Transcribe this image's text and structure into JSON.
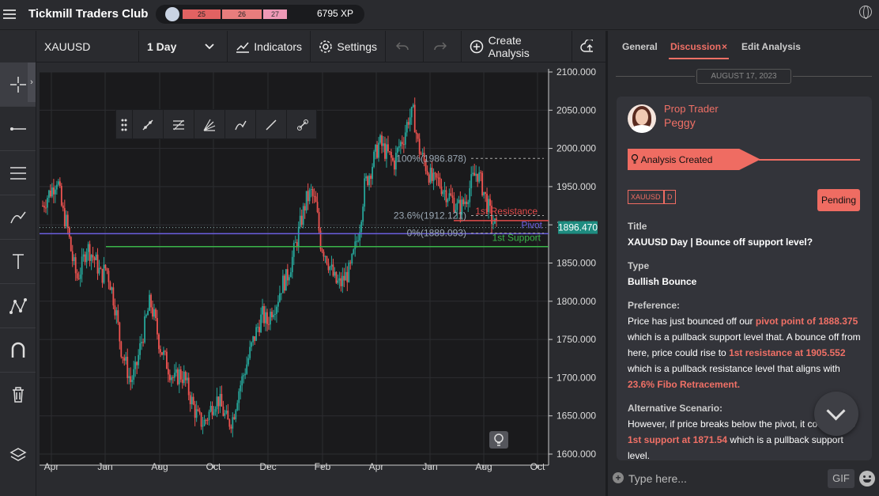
{
  "header": {
    "title": "Tickmill Traders Club",
    "xp_segments": [
      "25",
      "26",
      "27"
    ],
    "xp": "6795 XP"
  },
  "toolbar": {
    "symbol": "XAUUSD",
    "interval": "1 Day",
    "indicators": "Indicators",
    "settings": "Settings",
    "create_analysis": "Create Analysis"
  },
  "left_tools": [
    "crosshair-icon",
    "horizontal-line-icon",
    "parallel-lines-icon",
    "brush-icon",
    "text-icon",
    "pattern-icon",
    "magnet-icon",
    "trash-icon",
    "layers-icon"
  ],
  "chart_data": {
    "type": "candlestick",
    "symbol": "XAUUSD",
    "x_ticks": [
      "Apr",
      "Jun",
      "Aug",
      "Oct",
      "Dec",
      "Feb",
      "Apr",
      "Jun",
      "Aug",
      "Oct"
    ],
    "y_ticks": [
      "2100.000",
      "2050.000",
      "2000.000",
      "1950.000",
      "1900.000",
      "1850.000",
      "1800.000",
      "1750.000",
      "1700.000",
      "1650.000",
      "1600.000"
    ],
    "ylim": [
      1600,
      2100
    ],
    "current_price": "1896.470",
    "price_path": [
      1925,
      1938,
      1948,
      1962,
      1918,
      1900,
      1858,
      1830,
      1845,
      1872,
      1862,
      1850,
      1832,
      1845,
      1820,
      1788,
      1740,
      1718,
      1695,
      1708,
      1740,
      1770,
      1800,
      1775,
      1742,
      1725,
      1710,
      1696,
      1705,
      1700,
      1680,
      1660,
      1645,
      1640,
      1652,
      1668,
      1672,
      1655,
      1640,
      1648,
      1680,
      1700,
      1722,
      1745,
      1765,
      1782,
      1772,
      1790,
      1800,
      1822,
      1830,
      1852,
      1878,
      1906,
      1932,
      1942,
      1925,
      1875,
      1862,
      1843,
      1825,
      1822,
      1832,
      1840,
      1868,
      1900,
      1952,
      1968,
      1988,
      2008,
      1998,
      1990,
      1980,
      2002,
      2015,
      2040,
      2045,
      2002,
      1985,
      1970,
      1955,
      1958,
      1948,
      1940,
      1932,
      1922,
      1925,
      1938,
      1958,
      1970,
      1952,
      1930,
      1908,
      1895
    ],
    "levels": [
      {
        "label": "1st Resistance",
        "value": 1905.552,
        "color": "#e24a4a"
      },
      {
        "label": "Pivot",
        "value": 1888.375,
        "color": "#6b5fe0"
      },
      {
        "label": "1st Support",
        "value": 1871.54,
        "color": "#3ab54a"
      }
    ],
    "fib": [
      {
        "label": "100%(1986.878)",
        "value": 1986.878
      },
      {
        "label": "23.6%(1912.121)",
        "value": 1912.121
      },
      {
        "label": "0%(1889.093)",
        "value": 1889.093
      }
    ]
  },
  "panel": {
    "tabs": [
      "General",
      "Discussion",
      "Edit Analysis"
    ],
    "close_x": "×",
    "date": "AUGUST 17, 2023",
    "role": "Prop Trader",
    "user": "Peggy",
    "created": "Analysis Created",
    "tag_symbol": "XAUUSD",
    "tag_tf": "D",
    "status": "Pending",
    "title_label": "Title",
    "title": "XAUUSD Day | Bounce off support level?",
    "type_label": "Type",
    "type": "Bullish Bounce",
    "pref_label": "Preference:",
    "pref": [
      {
        "t": "Price has just bounced off our ",
        "h": false
      },
      {
        "t": "pivot point of 1888.375",
        "h": true
      },
      {
        "t": " which is a pullback support level that. A bounce off from here, price could rise to ",
        "h": false
      },
      {
        "t": "1st resistance at 1905.552",
        "h": true
      },
      {
        "t": " which is a pullback resistance level that aligns with ",
        "h": false
      },
      {
        "t": "23.6% Fibo Retracement.",
        "h": true
      }
    ],
    "alt_label": "Alternative Scenario:",
    "alt": [
      {
        "t": "However, if price breaks below the pivot, it could fall to ",
        "h": false
      },
      {
        "t": "1st support at 1871.54",
        "h": true
      },
      {
        "t": " which is a pullback support level.",
        "h": false
      }
    ],
    "placeholder": "Type here...",
    "gif": "GIF"
  }
}
